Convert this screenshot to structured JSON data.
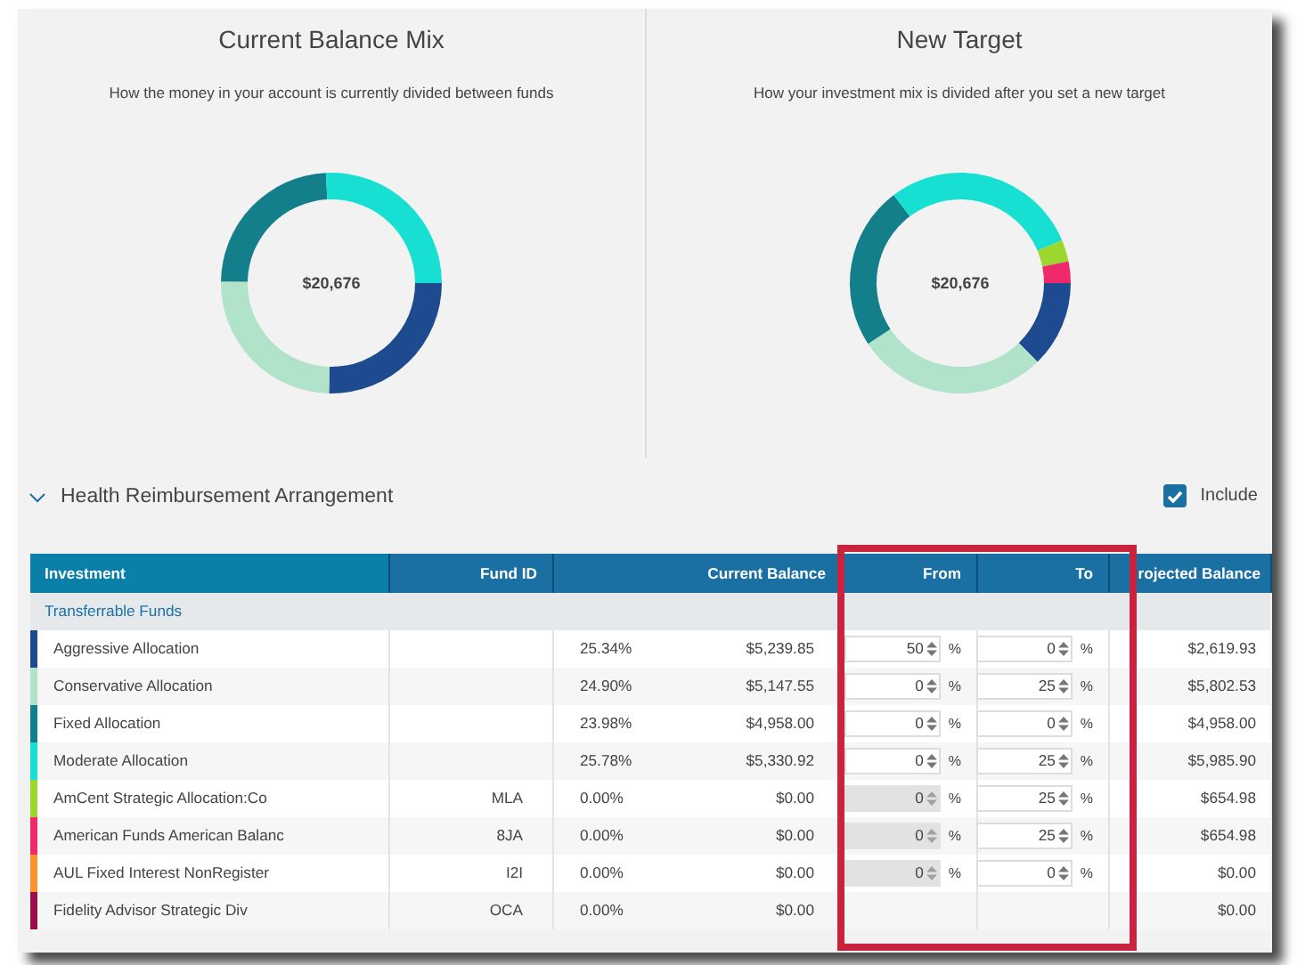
{
  "charts": [
    {
      "title": "Current Balance Mix",
      "subtitle": "How the money in your account is currently divided between funds",
      "total": "$20,676"
    },
    {
      "title": "New Target",
      "subtitle": "How your investment mix is divided after you set a new target",
      "total": "$20,676"
    }
  ],
  "section": {
    "title": "Health Reimbursement Arrangement",
    "expanded": true,
    "include": {
      "label": "Include",
      "checked": true
    }
  },
  "table": {
    "columns": [
      "Investment",
      "Fund ID",
      "Current Balance",
      "From",
      "To",
      "rojected Balance"
    ],
    "group": "Transferrable Funds",
    "rows": [
      {
        "name": "Aggressive Allocation",
        "color": "#1e4b8f",
        "fund_id": "",
        "percent": "25.34%",
        "balance": "$5,239.85",
        "from": {
          "value": "50",
          "disabled": false,
          "unit": "%"
        },
        "to": {
          "value": "0",
          "disabled": false,
          "unit": "%"
        },
        "projected": "$2,619.93"
      },
      {
        "name": "Conservative Allocation",
        "color": "#b0e3c9",
        "fund_id": "",
        "percent": "24.90%",
        "balance": "$5,147.55",
        "from": {
          "value": "0",
          "disabled": false,
          "unit": "%"
        },
        "to": {
          "value": "25",
          "disabled": false,
          "unit": "%"
        },
        "projected": "$5,802.53"
      },
      {
        "name": "Fixed Allocation",
        "color": "#137f8a",
        "fund_id": "",
        "percent": "23.98%",
        "balance": "$4,958.00",
        "from": {
          "value": "0",
          "disabled": false,
          "unit": "%"
        },
        "to": {
          "value": "0",
          "disabled": false,
          "unit": "%"
        },
        "projected": "$4,958.00"
      },
      {
        "name": "Moderate Allocation",
        "color": "#17e0d2",
        "fund_id": "",
        "percent": "25.78%",
        "balance": "$5,330.92",
        "from": {
          "value": "0",
          "disabled": false,
          "unit": "%"
        },
        "to": {
          "value": "25",
          "disabled": false,
          "unit": "%"
        },
        "projected": "$5,985.90"
      },
      {
        "name": "AmCent Strategic Allocation:Co",
        "color": "#9bd72f",
        "fund_id": "MLA",
        "percent": "0.00%",
        "balance": "$0.00",
        "from": {
          "value": "0",
          "disabled": true,
          "unit": "%"
        },
        "to": {
          "value": "25",
          "disabled": false,
          "unit": "%"
        },
        "projected": "$654.98"
      },
      {
        "name": "American Funds American Balanc",
        "color": "#ee2a6b",
        "fund_id": "8JA",
        "percent": "0.00%",
        "balance": "$0.00",
        "from": {
          "value": "0",
          "disabled": true,
          "unit": "%"
        },
        "to": {
          "value": "25",
          "disabled": false,
          "unit": "%"
        },
        "projected": "$654.98"
      },
      {
        "name": "AUL Fixed Interest NonRegister",
        "color": "#f7932f",
        "fund_id": "I2I",
        "percent": "0.00%",
        "balance": "$0.00",
        "from": {
          "value": "0",
          "disabled": true,
          "unit": "%"
        },
        "to": {
          "value": "0",
          "disabled": false,
          "unit": "%"
        },
        "projected": "$0.00"
      },
      {
        "name": "Fidelity Advisor Strategic Div",
        "color": "#9b0d4d",
        "fund_id": "OCA",
        "percent": "0.00%",
        "balance": "$0.00",
        "projected": "$0.00"
      }
    ]
  }
}
